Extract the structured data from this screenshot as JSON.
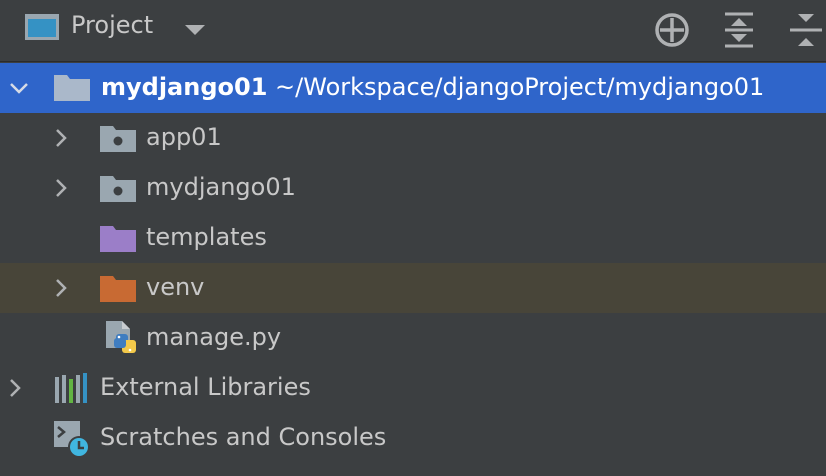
{
  "header": {
    "title": "Project",
    "icons": [
      "project-window-icon",
      "chevron-down-icon",
      "locate-target-icon",
      "expand-all-icon",
      "collapse-all-icon"
    ]
  },
  "tree": {
    "root": {
      "name": "mydjango01",
      "path": "~/Workspace/djangoProject/mydjango01"
    },
    "items": [
      {
        "label": "app01",
        "icon": "python-package-folder-icon"
      },
      {
        "label": "mydjango01",
        "icon": "python-package-folder-icon"
      },
      {
        "label": "templates",
        "icon": "templates-folder-icon"
      },
      {
        "label": "venv",
        "icon": "excluded-folder-icon"
      },
      {
        "label": "manage.py",
        "icon": "python-file-icon"
      }
    ],
    "external_libraries": "External Libraries",
    "scratches": "Scratches and Consoles"
  },
  "colors": {
    "background": "#3c3f41",
    "selection": "#2f65ca",
    "excluded_row": "#484539",
    "folder_blue": "#aab8ca",
    "folder_purple": "#9b7ec8",
    "folder_orange": "#c86a33"
  }
}
